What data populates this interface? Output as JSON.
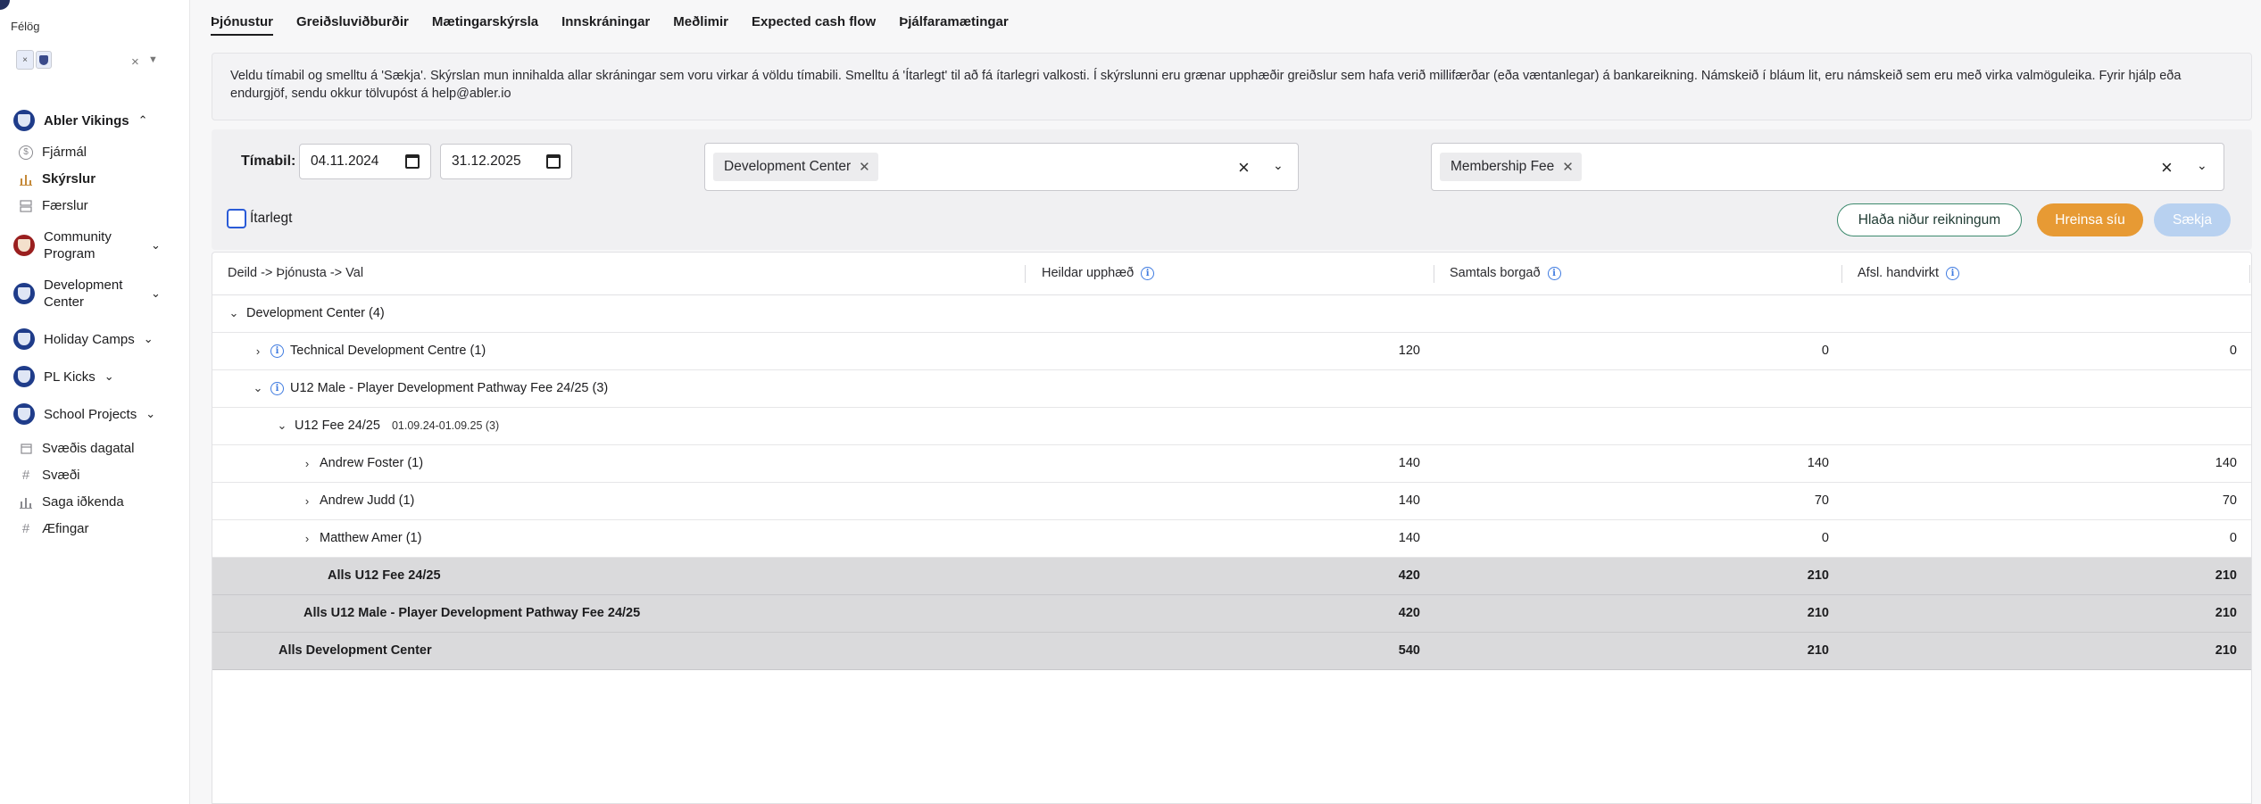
{
  "sidebar": {
    "felog_label": "Félög",
    "chip_label": "×",
    "orgs": [
      {
        "label": "Abler Vikings",
        "icon": "club-crest-icon"
      },
      {
        "label": "Community Program",
        "icon": "club-crest-icon"
      },
      {
        "label": "Development Center",
        "icon": "club-crest-icon"
      },
      {
        "label": "Holiday Camps",
        "icon": "club-crest-icon"
      },
      {
        "label": "PL Kicks",
        "icon": "club-crest-icon"
      },
      {
        "label": "School Projects",
        "icon": "club-crest-icon"
      }
    ],
    "finance_items": [
      {
        "label": "Fjármál",
        "icon": "dollar-circle-icon"
      },
      {
        "label": "Skýrslur",
        "icon": "bar-chart-icon"
      },
      {
        "label": "Færslur",
        "icon": "list-icon"
      }
    ],
    "bottom_items": [
      {
        "label": "Svæðis dagatal",
        "icon": "calendar-icon"
      },
      {
        "label": "Svæði",
        "icon": "hash-icon"
      },
      {
        "label": "Saga iðkenda",
        "icon": "bar-chart-icon"
      },
      {
        "label": "Æfingar",
        "icon": "hash-icon"
      }
    ]
  },
  "tabs": [
    {
      "label": "Þjónustur",
      "active": true
    },
    {
      "label": "Greiðsluviðburðir"
    },
    {
      "label": "Mætingarskýrsla"
    },
    {
      "label": "Innskráningar"
    },
    {
      "label": "Meðlimir"
    },
    {
      "label": "Expected cash flow"
    },
    {
      "label": "Þjálfaramætingar"
    }
  ],
  "info_text": "Veldu tímabil og smelltu á 'Sækja'. Skýrslan mun innihalda allar skráningar sem voru virkar á völdu tímabili. Smelltu á 'Ítarlegt' til að fá ítarlegri valkosti. Í skýrslunni eru grænar upphæðir greiðslur sem hafa verið millifærðar (eða væntanlegar) á bankareikning. Námskeið í bláum lit, eru námskeið sem eru með virka valmöguleika. Fyrir hjálp eða endurgjöf, sendu okkur tölvupóst á help@abler.io",
  "filters": {
    "period_label": "Tímabil:",
    "date_from": "04.11.2024",
    "date_to": "31.12.2025",
    "department_tag": "Development Center",
    "fee_tag": "Membership Fee",
    "detailed_label": "Ítarlegt",
    "download_label": "Hlaða niður reikningum",
    "clear_label": "Hreinsa síu",
    "fetch_label": "Sækja"
  },
  "table": {
    "headers": {
      "name": "Deild -> Þjónusta -> Val",
      "total": "Heildar upphæð",
      "paid": "Samtals borgað",
      "discount": "Afsl. handvirkt"
    },
    "rows": [
      {
        "name": "Development Center (4)",
        "total": "",
        "paid": "",
        "discount": ""
      },
      {
        "name": "Technical Development Centre (1)",
        "total": "120",
        "paid": "0",
        "discount": "0"
      },
      {
        "name": "U12 Male - Player Development Pathway Fee 24/25 (3)",
        "total": "",
        "paid": "",
        "discount": ""
      },
      {
        "name": "U12 Fee 24/25",
        "dates": "01.09.24-01.09.25 (3)",
        "total": "",
        "paid": "",
        "discount": ""
      },
      {
        "name": "Andrew Foster (1)",
        "total": "140",
        "paid": "140",
        "discount": "140"
      },
      {
        "name": "Andrew Judd (1)",
        "total": "140",
        "paid": "70",
        "discount": "70"
      },
      {
        "name": "Matthew Amer (1)",
        "total": "140",
        "paid": "0",
        "discount": "0"
      },
      {
        "name": "Alls U12 Fee 24/25",
        "total": "420",
        "paid": "210",
        "discount": "210"
      },
      {
        "name": "Alls U12 Male - Player Development Pathway Fee 24/25",
        "total": "420",
        "paid": "210",
        "discount": "210"
      },
      {
        "name": "Alls Development Center",
        "total": "540",
        "paid": "210",
        "discount": "210"
      }
    ]
  }
}
